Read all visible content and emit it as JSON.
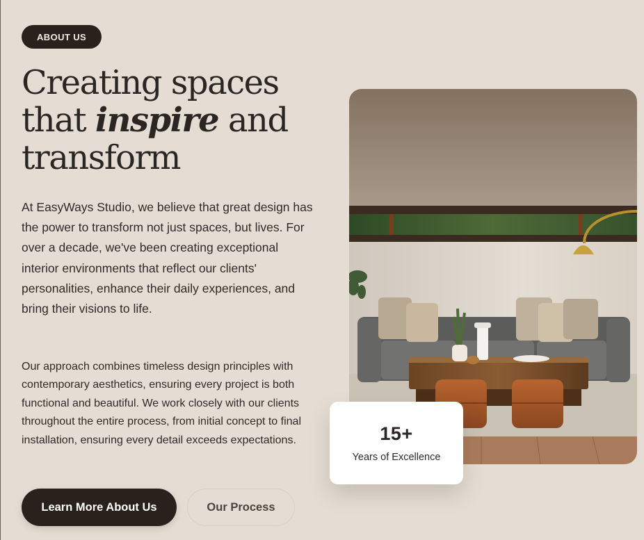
{
  "badge": {
    "label": "ABOUT US"
  },
  "heading": {
    "line1": "Creating spaces",
    "line2_before": "that ",
    "line2_emphasis": "inspire",
    "line2_after": " and",
    "line3": "transform"
  },
  "paragraphs": {
    "intro": "At EasyWays Studio, we believe that great design has the power to transform not just spaces, but lives. For over a decade, we've been creating exceptional interior environments that reflect our clients' personalities, enhance their daily experiences, and bring their visions to life.",
    "approach": "Our approach combines timeless design principles with contemporary aesthetics, ensuring every project is both functional and beautiful. We work closely with our clients throughout the entire process, from initial concept to final installation, ensuring every detail exceeds expectations."
  },
  "buttons": {
    "primary": "Learn More About Us",
    "secondary": "Our Process"
  },
  "stat": {
    "number": "15+",
    "label": "Years of Excellence"
  },
  "colors": {
    "background": "#e5ddd3",
    "dark": "#2b211c",
    "card": "#ffffff"
  }
}
